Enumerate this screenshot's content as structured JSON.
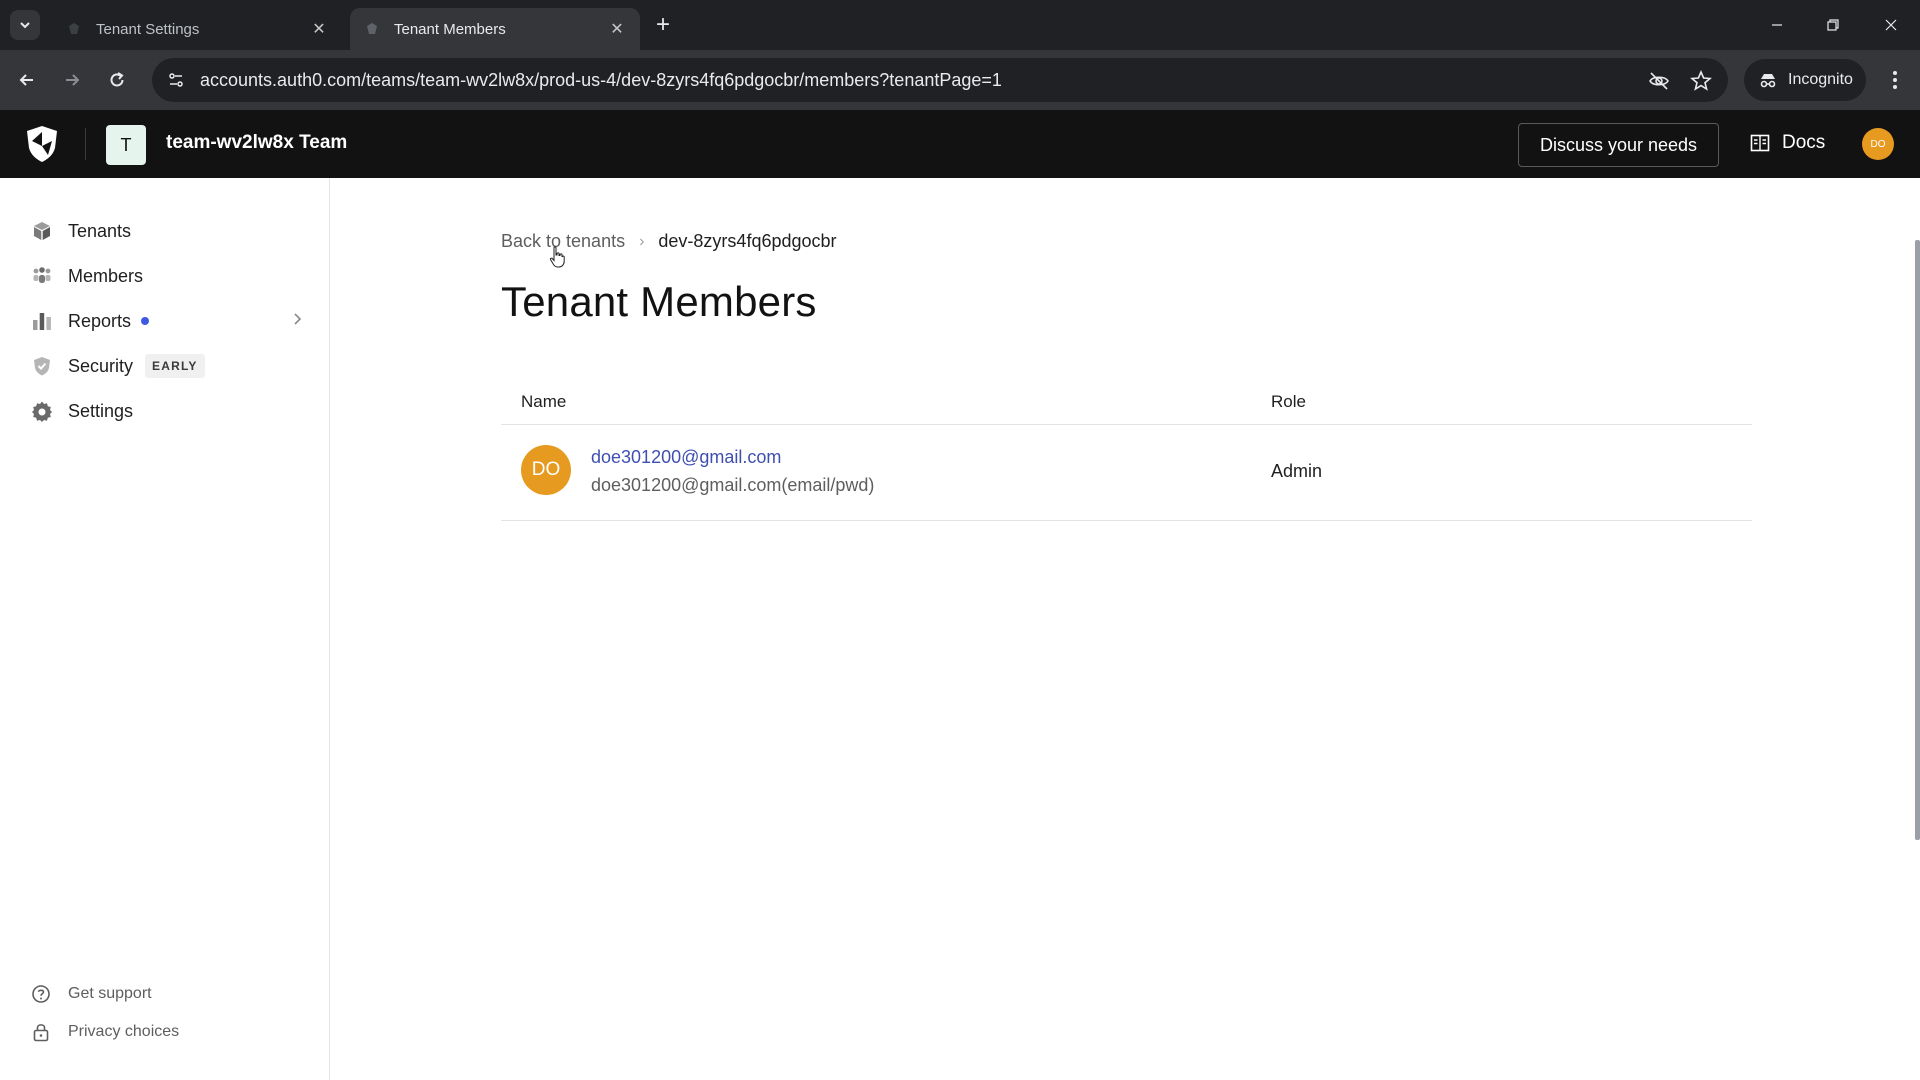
{
  "browser": {
    "tabs": [
      {
        "title": "Tenant Settings",
        "active": false
      },
      {
        "title": "Tenant Members",
        "active": true
      }
    ],
    "url": "accounts.auth0.com/teams/team-wv2lw8x/prod-us-4/dev-8zyrs4fq6pdgocbr/members?tenantPage=1",
    "incognito_label": "Incognito"
  },
  "header": {
    "team_initial": "T",
    "team_name": "team-wv2lw8x Team",
    "discuss_label": "Discuss your needs",
    "docs_label": "Docs",
    "user_initials": "DO"
  },
  "sidebar": {
    "items": [
      {
        "label": "Tenants",
        "icon": "cube-icon"
      },
      {
        "label": "Members",
        "icon": "people-icon"
      },
      {
        "label": "Reports",
        "icon": "bar-chart-icon"
      },
      {
        "label": "Security",
        "icon": "shield-icon",
        "badge": "EARLY"
      },
      {
        "label": "Settings",
        "icon": "gear-icon"
      }
    ],
    "footer": [
      {
        "label": "Get support",
        "icon": "help-circle-icon"
      },
      {
        "label": "Privacy choices",
        "icon": "lock-icon"
      }
    ]
  },
  "main": {
    "breadcrumb": {
      "back": "Back to tenants",
      "current": "dev-8zyrs4fq6pdgocbr"
    },
    "title": "Tenant Members",
    "table": {
      "columns": [
        "Name",
        "Role"
      ],
      "rows": [
        {
          "initials": "DO",
          "email": "doe301200@gmail.com",
          "connection": "doe301200@gmail.com(email/pwd)",
          "role": "Admin"
        }
      ]
    }
  },
  "colors": {
    "header_bg": "#121212",
    "avatar_orange": "#e69a1f",
    "link_blue": "#3f4fb0",
    "reports_dot": "#3f59e4"
  }
}
